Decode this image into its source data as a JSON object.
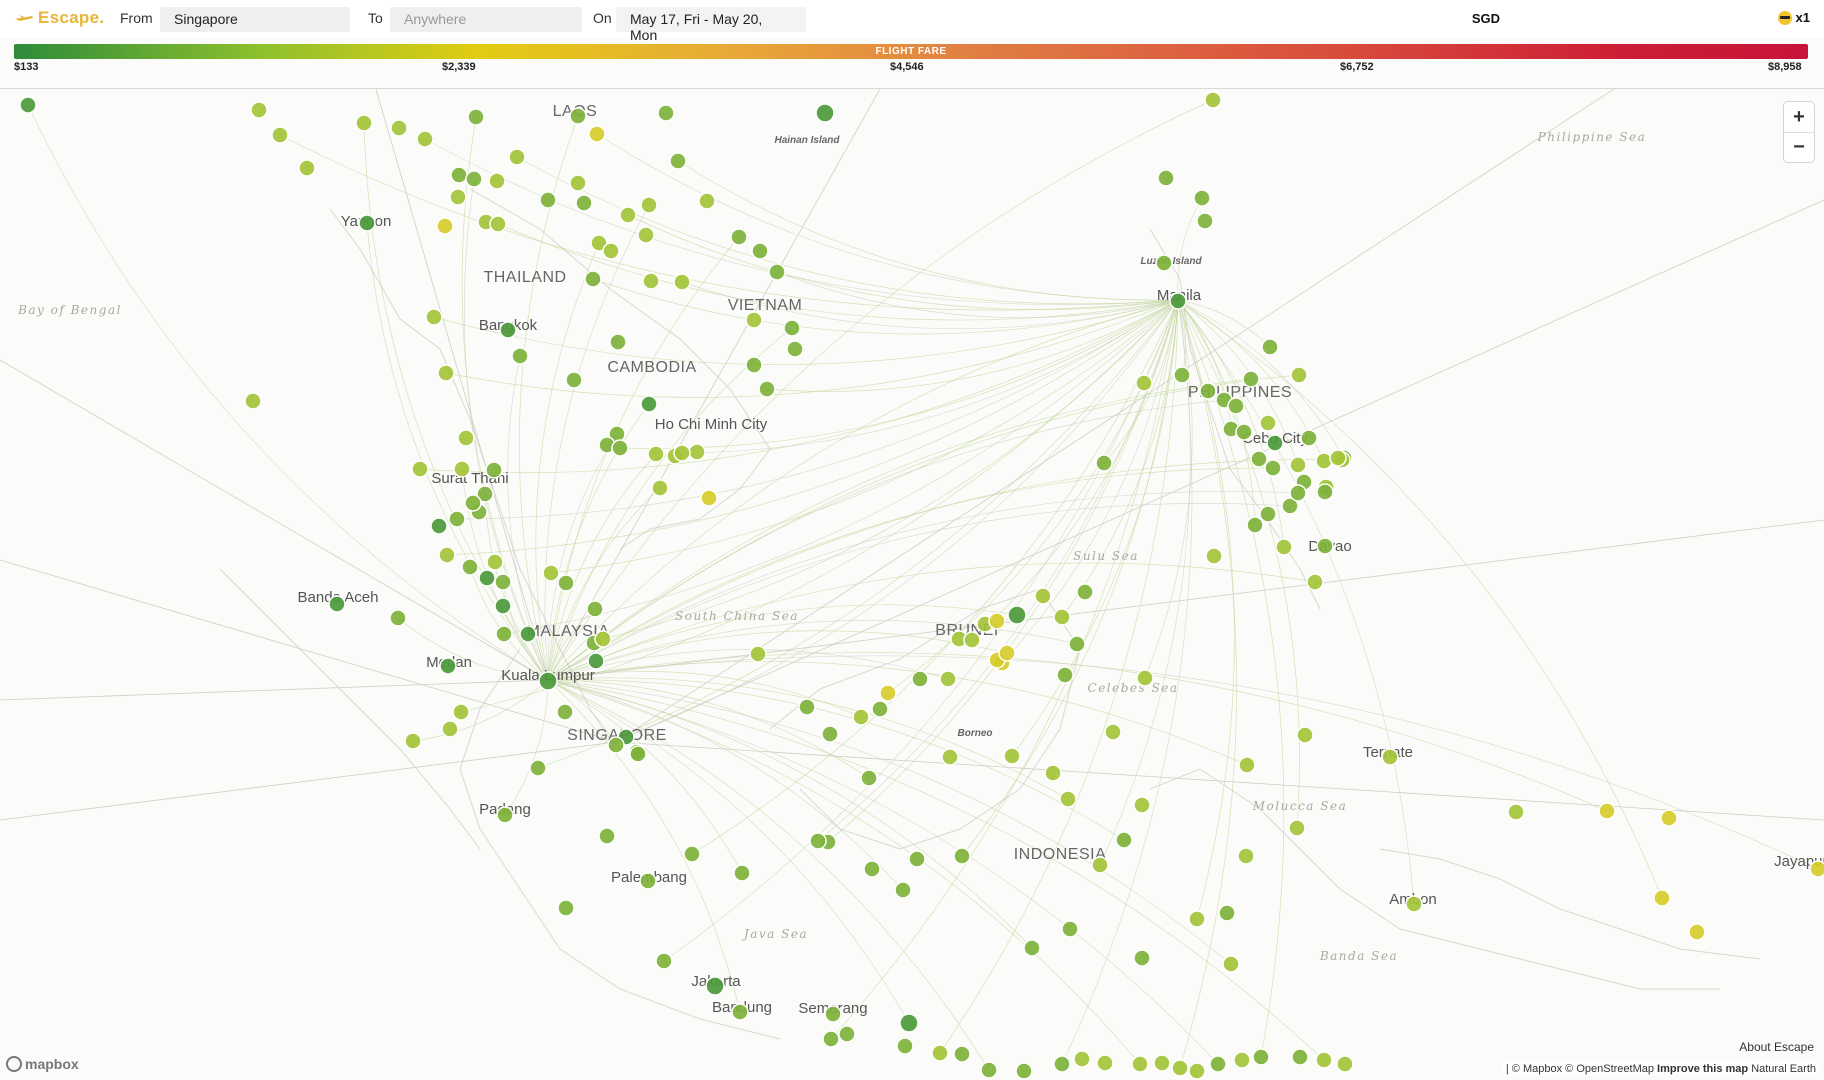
{
  "app": {
    "brand": "Escape."
  },
  "search": {
    "from_label": "From",
    "from_value": "Singapore",
    "to_label": "To",
    "to_placeholder": "Anywhere",
    "on_label": "On",
    "dates": "May 17, Fri - May 20, Mon"
  },
  "currency": "SGD",
  "travellers": "x1",
  "fare_scale": {
    "label": "FLIGHT FARE",
    "ticks": [
      "$133",
      "$2,339",
      "$4,546",
      "$6,752",
      "$8,958"
    ],
    "colors": {
      "low": "#2e8b3a",
      "mid": "#e2cc12",
      "high": "#c8143a"
    }
  },
  "map": {
    "place_labels": [
      {
        "text": "LAOS",
        "kind": "country"
      },
      {
        "text": "THAILAND",
        "kind": "country"
      },
      {
        "text": "VIETNAM",
        "kind": "country"
      },
      {
        "text": "CAMBODIA",
        "kind": "country"
      },
      {
        "text": "PHILIPPINES",
        "kind": "country"
      },
      {
        "text": "MALAYSIA",
        "kind": "country"
      },
      {
        "text": "SINGAPORE",
        "kind": "country"
      },
      {
        "text": "BRUNEI",
        "kind": "country"
      },
      {
        "text": "INDONESIA",
        "kind": "country"
      },
      {
        "text": "Yangon",
        "kind": "city"
      },
      {
        "text": "Bangkok",
        "kind": "city"
      },
      {
        "text": "Ho Chi Minh City",
        "kind": "city"
      },
      {
        "text": "Surat Thani",
        "kind": "city"
      },
      {
        "text": "Banda Aceh",
        "kind": "city"
      },
      {
        "text": "Medan",
        "kind": "city"
      },
      {
        "text": "Kuala Lumpur",
        "kind": "city"
      },
      {
        "text": "Padang",
        "kind": "city"
      },
      {
        "text": "Palembang",
        "kind": "city"
      },
      {
        "text": "Jakarta",
        "kind": "city"
      },
      {
        "text": "Bandung",
        "kind": "city"
      },
      {
        "text": "Semarang",
        "kind": "city"
      },
      {
        "text": "Manila",
        "kind": "city"
      },
      {
        "text": "Cebu City",
        "kind": "city"
      },
      {
        "text": "Davao",
        "kind": "city"
      },
      {
        "text": "Ternate",
        "kind": "city"
      },
      {
        "text": "Ambon",
        "kind": "city"
      },
      {
        "text": "Jayapura",
        "kind": "city"
      },
      {
        "text": "Hainan Island",
        "kind": "island"
      },
      {
        "text": "Luzon Island",
        "kind": "island"
      },
      {
        "text": "Borneo",
        "kind": "island"
      },
      {
        "text": "Bay of Bengal",
        "kind": "sea"
      },
      {
        "text": "Philippine Sea",
        "kind": "sea"
      },
      {
        "text": "South China Sea",
        "kind": "sea"
      },
      {
        "text": "Sulu Sea",
        "kind": "sea"
      },
      {
        "text": "Celebes Sea",
        "kind": "sea"
      },
      {
        "text": "Molucca Sea",
        "kind": "sea"
      },
      {
        "text": "Java Sea",
        "kind": "sea"
      },
      {
        "text": "Banda Sea",
        "kind": "sea"
      }
    ],
    "zoom_in": "+",
    "zoom_out": "−",
    "mapbox_logo": "mapbox",
    "about": "About Escape",
    "attribution": "| © Mapbox © OpenStreetMap",
    "improve": "Improve this map",
    "natural_earth": "Natural Earth"
  }
}
